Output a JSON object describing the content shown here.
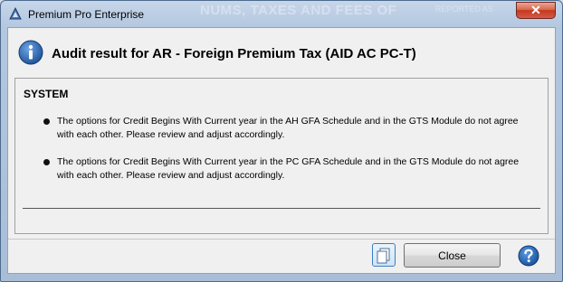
{
  "window": {
    "title": "Premium Pro Enterprise",
    "background_title": "NUMS, TAXES AND FEES OF",
    "background_subtitle": "REPORTED AS"
  },
  "dialog": {
    "heading": "Audit result for AR - Foreign Premium Tax (AID AC PC-T)",
    "section": "SYSTEM",
    "messages": [
      "The options for Credit Begins With Current year in the AH GFA Schedule and in the GTS Module do not agree with each other. Please review and adjust accordingly.",
      "The options for Credit Begins With Current year in the PC GFA Schedule and in the GTS Module do not agree with each other. Please review and adjust accordingly."
    ]
  },
  "footer": {
    "close_label": "Close"
  },
  "icons": {
    "app": "app-logo-icon",
    "info": "info-icon",
    "copy": "copy-icon",
    "help": "help-icon",
    "window_close": "close-icon"
  },
  "colors": {
    "title_gradient": "#b3c7e0",
    "close_red": "#c3391c",
    "info_blue": "#1f5fa8"
  }
}
